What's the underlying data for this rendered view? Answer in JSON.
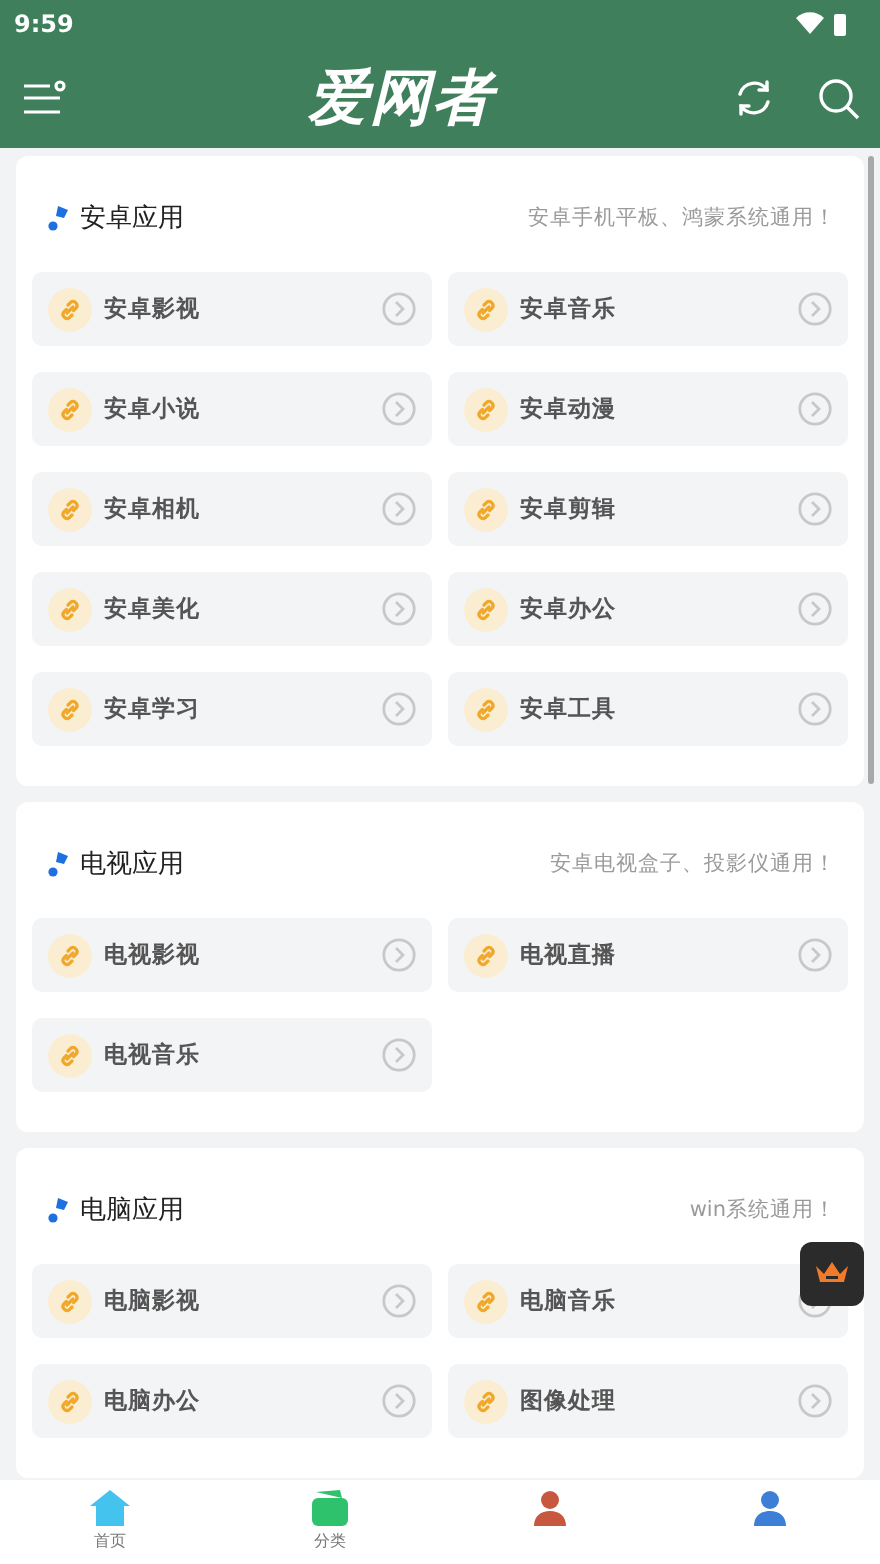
{
  "status_bar": {
    "time": "9:59"
  },
  "header": {
    "title": "爱网者"
  },
  "sections": [
    {
      "title": "安卓应用",
      "subtitle": "安卓手机平板、鸿蒙系统通用！",
      "items": [
        "安卓影视",
        "安卓音乐",
        "安卓小说",
        "安卓动漫",
        "安卓相机",
        "安卓剪辑",
        "安卓美化",
        "安卓办公",
        "安卓学习",
        "安卓工具"
      ]
    },
    {
      "title": "电视应用",
      "subtitle": "安卓电视盒子、投影仪通用！",
      "items": [
        "电视影视",
        "电视直播",
        "电视音乐"
      ]
    },
    {
      "title": "电脑应用",
      "subtitle": "win系统通用！",
      "items": [
        "电脑影视",
        "电脑音乐",
        "电脑办公",
        "图像处理"
      ]
    }
  ],
  "bottom_nav": [
    {
      "kind": "home",
      "label": "首页",
      "color": "#45c3ef"
    },
    {
      "kind": "wallet",
      "label": "分类",
      "color": "#2fc26d"
    },
    {
      "kind": "person",
      "color": "#c8573f"
    },
    {
      "kind": "person",
      "color": "#3d7fd6"
    }
  ]
}
